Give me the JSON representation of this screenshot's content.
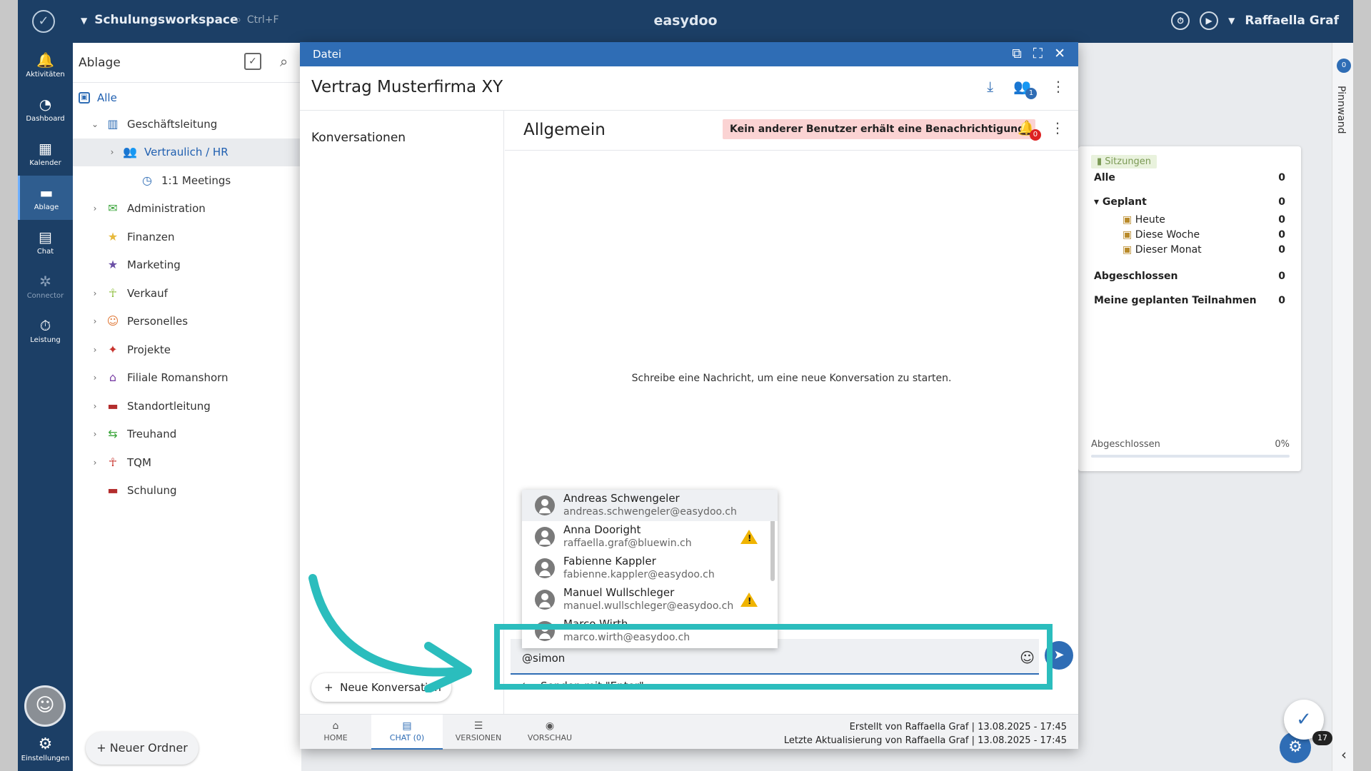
{
  "app": {
    "workspace": "Schulungsworkspace",
    "search_hint": "Ctrl+F",
    "brand": "easydoo",
    "user": "Raffaella Graf"
  },
  "sidebar": {
    "items": [
      {
        "label": "Aktivitäten",
        "icon": "bell-icon"
      },
      {
        "label": "Dashboard",
        "icon": "gauge-icon"
      },
      {
        "label": "Kalender",
        "icon": "calendar-icon"
      },
      {
        "label": "Ablage",
        "icon": "folder-icon"
      },
      {
        "label": "Chat",
        "icon": "chat-icon"
      },
      {
        "label": "Connector",
        "icon": "connector-icon"
      },
      {
        "label": "Leistung",
        "icon": "stopwatch-icon"
      }
    ],
    "settings": "Einstellungen"
  },
  "files": {
    "title": "Ablage",
    "all": "Alle",
    "tree": [
      {
        "label": "Geschäftsleitung",
        "icon": "building-icon",
        "color": "#2f6db5"
      },
      {
        "label": "Vertraulich / HR",
        "icon": "people-icon",
        "color": "#2f6db5"
      },
      {
        "label": "1:1 Meetings",
        "icon": "clock-icon",
        "color": "#2f6db5"
      },
      {
        "label": "Administration",
        "icon": "mail-icon",
        "color": "#3aa53a"
      },
      {
        "label": "Finanzen",
        "icon": "folder-star-icon",
        "color": "#e7b93b"
      },
      {
        "label": "Marketing",
        "icon": "star-icon",
        "color": "#6a4fa5"
      },
      {
        "label": "Verkauf",
        "icon": "person-icon",
        "color": "#8fbf3f"
      },
      {
        "label": "Personelles",
        "icon": "group-icon",
        "color": "#e07a3a"
      },
      {
        "label": "Projekte",
        "icon": "gamepad-icon",
        "color": "#c8342e"
      },
      {
        "label": "Filiale Romanshorn",
        "icon": "bank-icon",
        "color": "#7a3fa5"
      },
      {
        "label": "Standortleitung",
        "icon": "folder-icon",
        "color": "#b32d2d"
      },
      {
        "label": "Treuhand",
        "icon": "transfer-icon",
        "color": "#3aa53a"
      },
      {
        "label": "TQM",
        "icon": "person-icon",
        "color": "#c8342e"
      },
      {
        "label": "Schulung",
        "icon": "folder-icon",
        "color": "#b32d2d"
      }
    ],
    "new_folder": "Neuer Ordner"
  },
  "sessions": {
    "tag": "Sitzungen",
    "rows": [
      {
        "label": "Alle",
        "value": "0"
      },
      {
        "label": "Geplant",
        "value": "0"
      },
      {
        "label": "Heute",
        "value": "0"
      },
      {
        "label": "Diese Woche",
        "value": "0"
      },
      {
        "label": "Dieser Monat",
        "value": "0"
      },
      {
        "label": "Abgeschlossen",
        "value": "0"
      },
      {
        "label": "Meine geplanten Teilnahmen",
        "value": "0"
      }
    ],
    "progress_label": "Abgeschlossen",
    "progress_value": "0%"
  },
  "right_strip": {
    "count": "0",
    "label": "Pinnwand"
  },
  "modal": {
    "title": "Datei",
    "doc_title": "Vertrag Musterfirma XY",
    "participants_badge": "1",
    "conversations_title": "Konversationen",
    "new_conversation": "Neue Konversation",
    "chat": {
      "title": "Allgemein",
      "warning": "Kein anderer Benutzer erhält eine Benachrichtigung.",
      "bell_badge": "0",
      "empty_text": "Schreibe eine Nachricht, um eine neue Konversation zu starten.",
      "input_value": "@simon",
      "send_with_enter": "Senden mit \"Enter\""
    },
    "mentions": [
      {
        "name": "Andreas Schwengeler",
        "email": "andreas.schwengeler@easydoo.ch",
        "warn": false
      },
      {
        "name": "Anna Dooright",
        "email": "raffaella.graf@bluewin.ch",
        "warn": true
      },
      {
        "name": "Fabienne Kappler",
        "email": "fabienne.kappler@easydoo.ch",
        "warn": false
      },
      {
        "name": "Manuel Wullschleger",
        "email": "manuel.wullschleger@easydoo.ch",
        "warn": true
      },
      {
        "name": "Marco Wirth",
        "email": "marco.wirth@easydoo.ch",
        "warn": false
      }
    ],
    "footer_tabs": [
      {
        "label": "HOME",
        "icon": "home-icon"
      },
      {
        "label": "CHAT (0)",
        "icon": "chat-icon"
      },
      {
        "label": "VERSIONEN",
        "icon": "list-icon"
      },
      {
        "label": "VORSCHAU",
        "icon": "eye-icon"
      }
    ],
    "created": "Erstellt von Raffaella Graf | 13.08.2025 - 17:45",
    "updated": "Letzte Aktualisierung von Raffaella Graf | 13.08.2025 - 17:45"
  },
  "fab_badge": "17",
  "colors": {
    "primary": "#2f6db5",
    "nav": "#1c3f66",
    "highlight": "#2bbdbd",
    "warning_bg": "#fbd3d3"
  }
}
